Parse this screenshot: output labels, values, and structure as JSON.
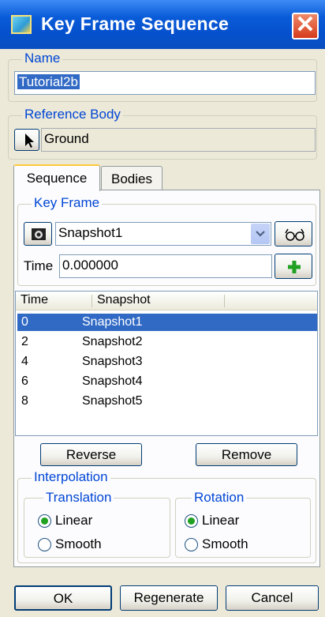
{
  "window": {
    "title": "Key Frame Sequence",
    "close_glyph": "✕"
  },
  "name_group": {
    "legend": "Name",
    "value": "Tutorial2b"
  },
  "reference_body": {
    "legend": "Reference Body",
    "pick_icon": "cursor-arrow-icon",
    "value": "Ground"
  },
  "tabs": [
    {
      "label": "Sequence",
      "active": true
    },
    {
      "label": "Bodies",
      "active": false
    }
  ],
  "key_frame": {
    "legend": "Key Frame",
    "camera_icon": "camera-icon",
    "snapshot_selected": "Snapshot1",
    "view_icon": "glasses-icon",
    "time_label": "Time",
    "time_value": "0.000000",
    "add_icon": "plus-icon"
  },
  "table": {
    "columns": [
      "Time",
      "Snapshot"
    ],
    "rows": [
      {
        "time": "0",
        "snapshot": "Snapshot1",
        "selected": true
      },
      {
        "time": "2",
        "snapshot": "Snapshot2",
        "selected": false
      },
      {
        "time": "4",
        "snapshot": "Snapshot3",
        "selected": false
      },
      {
        "time": "6",
        "snapshot": "Snapshot4",
        "selected": false
      },
      {
        "time": "8",
        "snapshot": "Snapshot5",
        "selected": false
      }
    ]
  },
  "buttons": {
    "reverse": "Reverse",
    "remove": "Remove",
    "ok": "OK",
    "regenerate": "Regenerate",
    "cancel": "Cancel"
  },
  "interpolation": {
    "legend": "Interpolation",
    "translation": {
      "legend": "Translation",
      "options": [
        "Linear",
        "Smooth"
      ],
      "selected": "Linear"
    },
    "rotation": {
      "legend": "Rotation",
      "options": [
        "Linear",
        "Smooth"
      ],
      "selected": "Linear"
    }
  },
  "colors": {
    "accent": "#0046D5",
    "selection": "#316AC5",
    "titlebar": "#0A5BD8",
    "add_green": "#21A121"
  }
}
